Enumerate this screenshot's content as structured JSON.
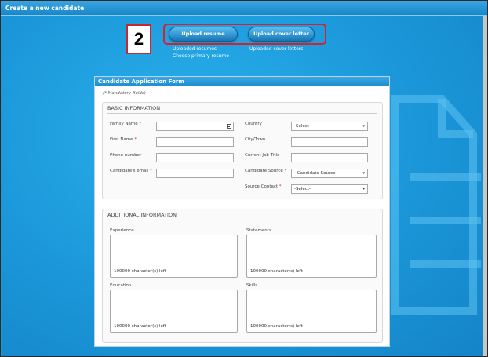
{
  "window": {
    "title": "Create a new candidate"
  },
  "annotation": {
    "step_number": "2"
  },
  "upload": {
    "resume_button": "Upload resume",
    "cover_letter_button": "Upload cover letter",
    "uploaded_resumes": "Uploaded resumes",
    "choose_primary_resume": "Choose primary resume",
    "uploaded_cover_letters": "Uploaded cover letters"
  },
  "form": {
    "title": "Candidate Application Form",
    "mandatory_note": "(* Mandatory fields)",
    "basic": {
      "legend": "BASIC INFORMATION",
      "family_name": "Family Name",
      "first_name": "First Name",
      "phone_number": "Phone number",
      "email": "Candidate's email",
      "country": "Country",
      "country_value": "-Select-",
      "city": "City/Town",
      "current_job_title": "Current Job Title",
      "candidate_source": "Candidate Source",
      "candidate_source_value": "- Candidate Source -",
      "source_contact": "Source Contact",
      "source_contact_value": "-Select-"
    },
    "additional": {
      "legend": "ADDITIONAL INFORMATION",
      "experience": "Experience",
      "statements": "Statements",
      "education": "Education",
      "skills": "Skills",
      "chars_left": "100000 character(s) left"
    }
  },
  "colors": {
    "accent": "#1e95d6",
    "highlight": "#d4232a",
    "required": "#dd2222"
  }
}
